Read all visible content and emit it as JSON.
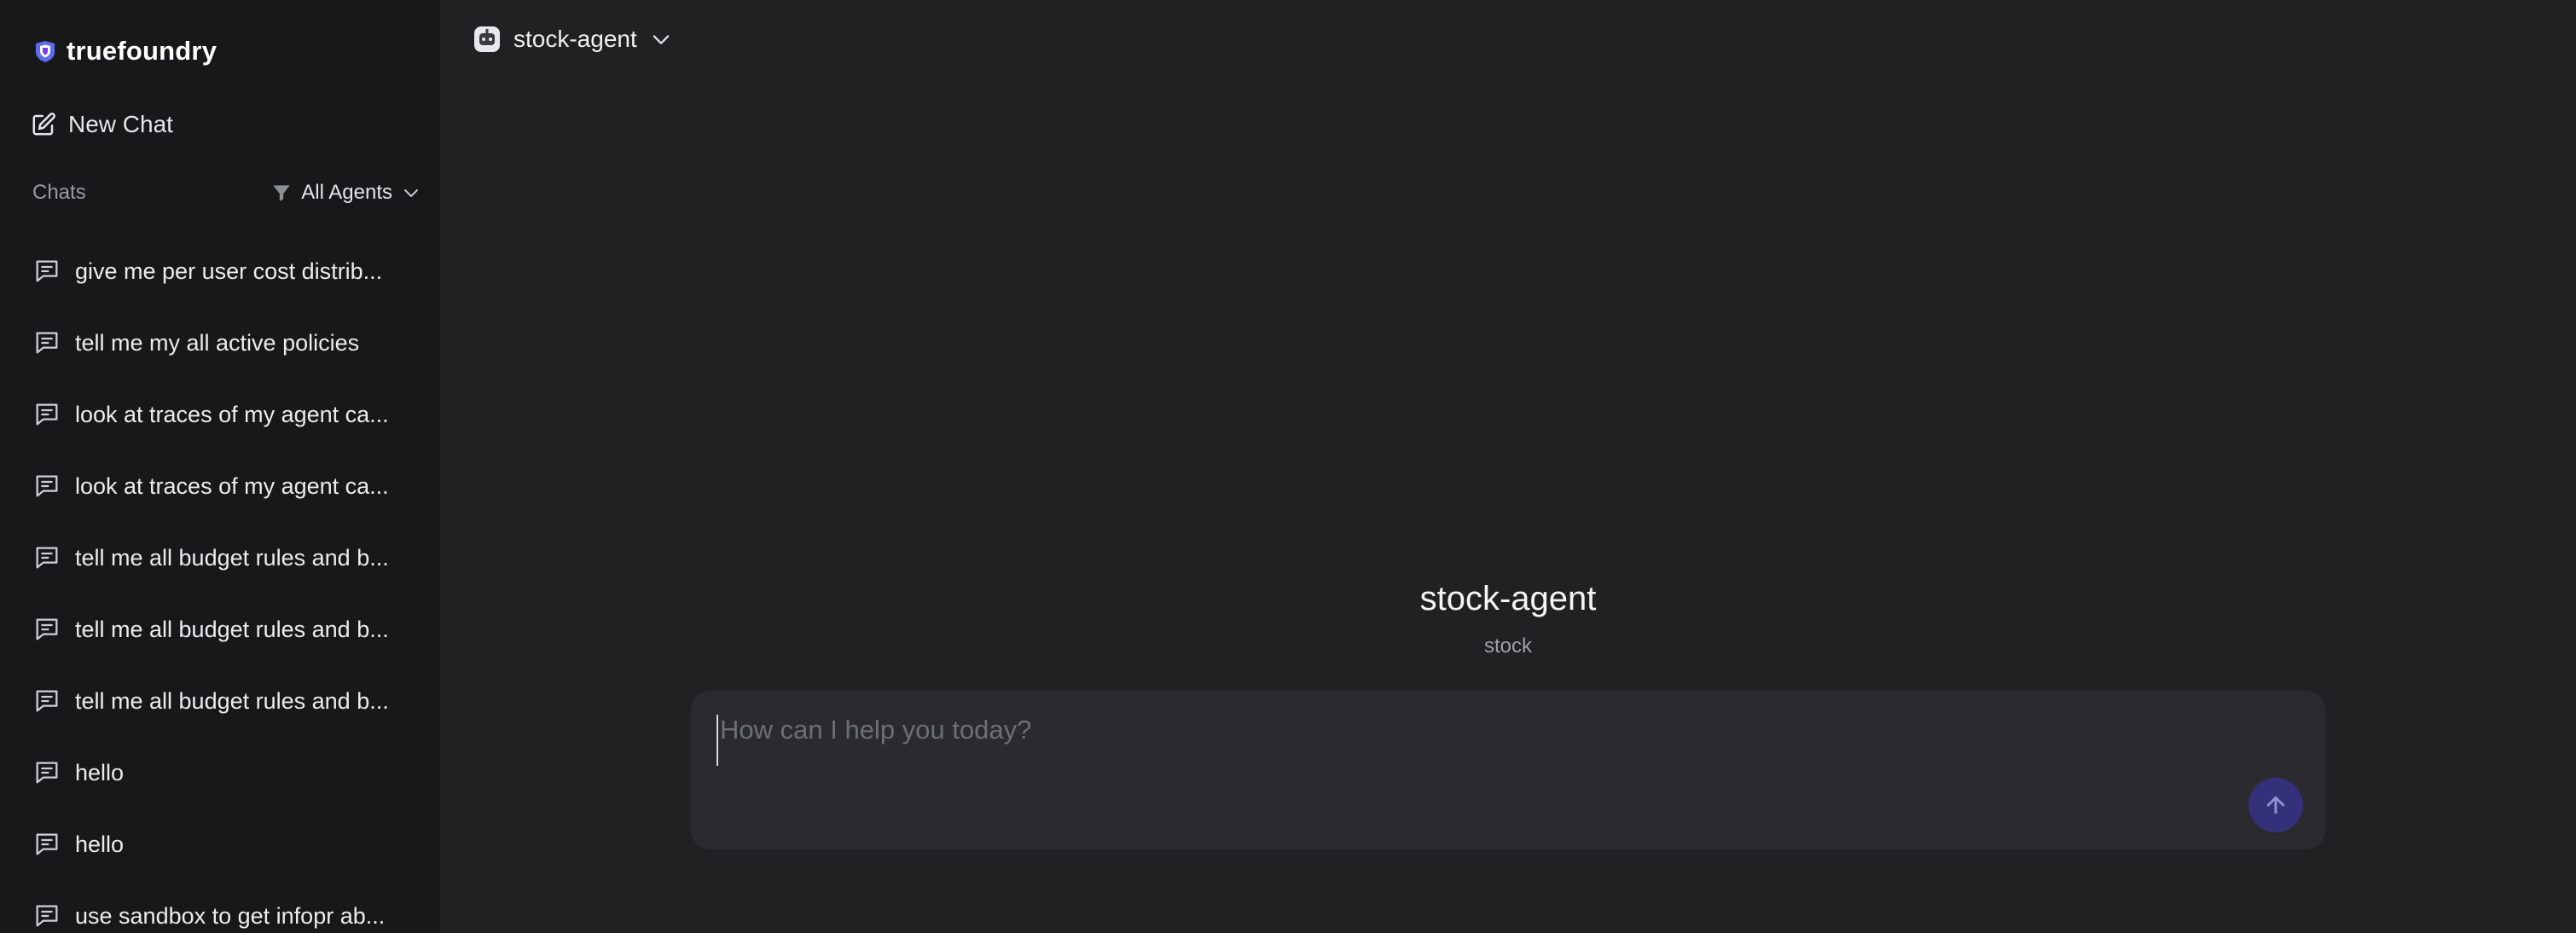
{
  "brand": {
    "name": "truefoundry",
    "logo_icon": "truefoundry-logo",
    "accent_color": "#4b5bd8"
  },
  "sidebar": {
    "new_chat_label": "New Chat",
    "new_chat_icon": "edit-icon",
    "chats_label": "Chats",
    "filter": {
      "icon": "filter-icon",
      "label": "All Agents"
    },
    "chats": [
      {
        "title": "give me per user cost distrib..."
      },
      {
        "title": "tell me my all active policies"
      },
      {
        "title": "look at traces of my agent ca..."
      },
      {
        "title": "look at traces of my agent ca..."
      },
      {
        "title": "tell me all budget rules and b..."
      },
      {
        "title": "tell me all budget rules and b..."
      },
      {
        "title": "tell me all budget rules and b..."
      },
      {
        "title": "hello"
      },
      {
        "title": "hello"
      },
      {
        "title": "use sandbox to get infopr ab..."
      }
    ]
  },
  "topbar": {
    "agent_name": "stock-agent",
    "agent_icon": "bot-icon"
  },
  "hero": {
    "title": "stock-agent",
    "subtitle": "stock"
  },
  "composer": {
    "placeholder": "How can I help you today?",
    "value": "",
    "send_icon": "arrow-up-icon",
    "send_color": "#34307a"
  }
}
